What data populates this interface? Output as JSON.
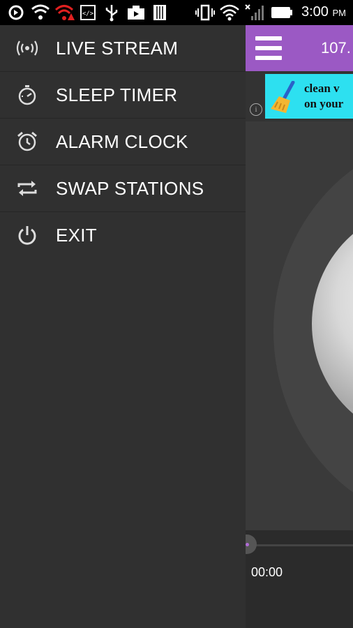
{
  "status_bar": {
    "time": "3:00",
    "ampm": "PM",
    "icons": [
      "sync-icon",
      "shield-wifi-icon",
      "wifi-alert-icon",
      "code-icon",
      "usb-icon",
      "camera-icon",
      "sim-icon",
      "vibrate-icon",
      "wifi-icon",
      "signal-icon",
      "battery-icon"
    ]
  },
  "drawer": {
    "items": [
      {
        "label": "LIVE STREAM",
        "icon": "broadcast-icon"
      },
      {
        "label": "SLEEP TIMER",
        "icon": "stopwatch-icon"
      },
      {
        "label": "ALARM CLOCK",
        "icon": "alarm-clock-icon"
      },
      {
        "label": "SWAP STATIONS",
        "icon": "swap-icon"
      },
      {
        "label": "EXIT",
        "icon": "power-icon"
      }
    ]
  },
  "app": {
    "station_title": "107.",
    "ad_text_line1": "clean v",
    "ad_text_line2": "on your",
    "ad_info": "i",
    "elapsed_time": "00:00",
    "accent_color": "#9b59c4",
    "ad_color": "#2de0f0"
  }
}
